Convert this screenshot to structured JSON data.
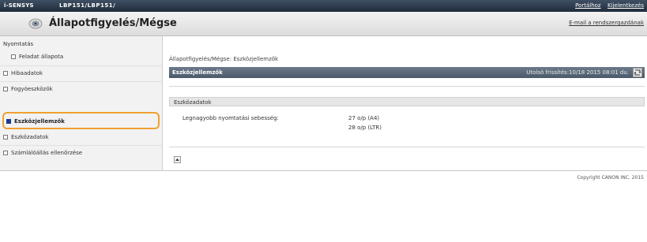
{
  "topbar": {
    "brand": "i-SENSYS",
    "model": "LBP151/LBP151/",
    "links": [
      "Portálhoz",
      "Kijelentkezés"
    ]
  },
  "header": {
    "title": "Állapotfigyelés/Mégse",
    "mail_link": "E-mail a rendszergazdának"
  },
  "sidebar": {
    "items": [
      {
        "label": "Nyomtatás",
        "level": 0,
        "active": false
      },
      {
        "label": "Feladat állapota",
        "level": 1,
        "active": false
      },
      {
        "label": "Hibaadatok",
        "level": 0,
        "active": false
      },
      {
        "label": "Fogyóeszközök",
        "level": 0,
        "active": false
      },
      {
        "label": "Eszközjellemzők",
        "level": 0,
        "active": true
      },
      {
        "label": "Eszközadatok",
        "level": 0,
        "active": false
      },
      {
        "label": "Számlálóállás ellenőrzése",
        "level": 0,
        "active": false
      }
    ]
  },
  "main": {
    "breadcrumb": "Állapotfigyelés/Mégse: Eszközjellemzők",
    "panel_title": "Eszközjellemzők",
    "last_updated": "Utolsó frissítés:10/18 2015 08:01 du.",
    "section_title": "Eszközadatok",
    "speed_label": "Legnagyobb nyomtatási sebesség:",
    "speed_a4": "27 o/p (A4)",
    "speed_ltr": "28 o/p (LTR)"
  },
  "footer": {
    "copyright": "Copyright CANON INC. 2015"
  },
  "colors": {
    "topbar": "#1f2c3c",
    "panel_header": "#5a6878",
    "highlight": "#f0a030",
    "active_bullet": "#1a3c8c"
  }
}
